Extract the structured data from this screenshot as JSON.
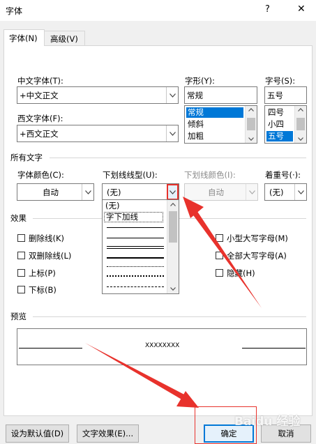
{
  "window": {
    "title": "字体",
    "help_label": "?",
    "close_label": "✕"
  },
  "tabs": [
    {
      "label": "字体(N)"
    },
    {
      "label": "高级(V)"
    }
  ],
  "font": {
    "chinese_label": "中文字体(T):",
    "chinese_value": "+中文正文",
    "western_label": "西文字体(F):",
    "western_value": "+西文正文",
    "style_label": "字形(Y):",
    "style_value": "常规",
    "style_options": [
      "常规",
      "倾斜",
      "加粗"
    ],
    "size_label": "字号(S):",
    "size_value": "五号",
    "size_options": [
      "四号",
      "小四",
      "五号"
    ]
  },
  "all_text": {
    "section_label": "所有文字",
    "color_label": "字体颜色(C):",
    "color_value": "自动",
    "underline_label": "下划线线型(U):",
    "underline_value": "(无)",
    "underline_color_label": "下划线颜色(I):",
    "underline_color_value": "自动",
    "emphasis_label": "着重号(·):",
    "emphasis_value": "(无)",
    "underline_options": [
      "(无)",
      "字下加线"
    ]
  },
  "effects": {
    "section_label": "效果",
    "left": [
      "删除线(K)",
      "双删除线(L)",
      "上标(P)",
      "下标(B)"
    ],
    "right": [
      "小型大写字母(M)",
      "全部大写字母(A)",
      "隐藏(H)"
    ]
  },
  "preview": {
    "section_label": "预览",
    "sample": "XXXXXXXX"
  },
  "buttons": {
    "default": "设为默认值(D)",
    "effects": "文字效果(E)...",
    "ok": "确定",
    "cancel": "取消"
  },
  "watermark": "Baidu 经验",
  "colors": {
    "accent": "#0078d7",
    "annotation": "#e8322c"
  }
}
